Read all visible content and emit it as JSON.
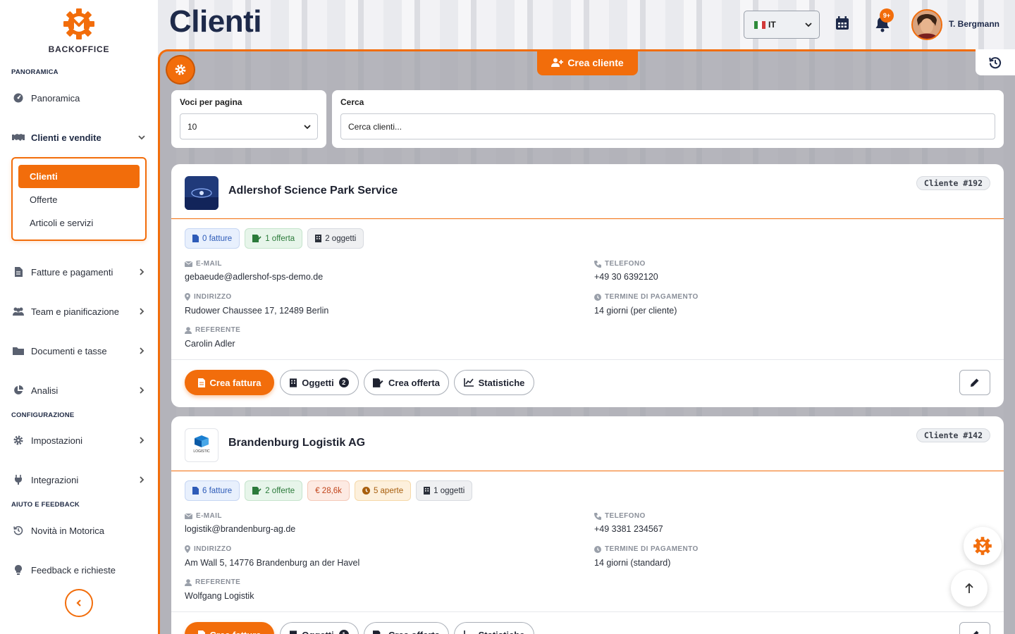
{
  "brand": {
    "name": "BACKOFFICE"
  },
  "header": {
    "title": "Clienti",
    "language": "IT",
    "notifications_badge": "9+",
    "user_name": "T. Bergmann"
  },
  "sidebar": {
    "sections": {
      "overview": "PANORAMICA",
      "configuration": "CONFIGURAZIONE",
      "help": "AIUTO E FEEDBACK"
    },
    "items": {
      "overview": "Panoramica",
      "clients_sales": "Clienti e vendite",
      "invoices": "Fatture e pagamenti",
      "team": "Team e pianificazione",
      "documents": "Documenti e tasse",
      "analysis": "Analisi",
      "settings": "Impostazioni",
      "integrations": "Integrazioni",
      "news": "Novità in Motorica",
      "feedback": "Feedback e richieste"
    },
    "sub_items": [
      "Clienti",
      "Offerte",
      "Articoli e servizi"
    ]
  },
  "toolbar": {
    "create_client": "Crea cliente"
  },
  "filters": {
    "per_page_label": "Voci per pagina",
    "per_page_value": "10",
    "search_label": "Cerca",
    "search_placeholder": "Cerca clienti..."
  },
  "labels": {
    "email": "E-MAIL",
    "phone": "TELEFONO",
    "address": "INDIRIZZO",
    "payment_terms": "TERMINE DI PAGAMENTO",
    "contact": "REFERENTE",
    "btn_invoice": "Crea fattura",
    "btn_objects": "Oggetti",
    "btn_offer": "Crea offerta",
    "btn_stats": "Statistiche"
  },
  "clients": [
    {
      "name": "Adlershof Science Park Service",
      "id": "Cliente #192",
      "badges": [
        "0 fatture",
        "1 offerta",
        "2 oggetti"
      ],
      "email": "gebaeude@adlershof-sps-demo.de",
      "phone": "+49 30 6392120",
      "address": "Rudower Chaussee 17, 12489 Berlin",
      "payment_terms": "14 giorni (per cliente)",
      "contact": "Carolin Adler",
      "objects_count": "2"
    },
    {
      "name": "Brandenburg Logistik AG",
      "id": "Cliente #142",
      "badges": [
        "6 fatture",
        "2 offerte",
        "€ 28,6k",
        "5 aperte",
        "1 oggetti"
      ],
      "email": "logistik@brandenburg-ag.de",
      "phone": "+49 3381 234567",
      "address": "Am Wall 5, 14776 Brandenburg an der Havel",
      "payment_terms": "14 giorni (standard)",
      "contact": "Wolfgang Logistik",
      "objects_count": "1",
      "logo_text": "LOGISTIC"
    }
  ],
  "colors": {
    "accent": "#f26d0b",
    "navy": "#1e2a4a"
  }
}
